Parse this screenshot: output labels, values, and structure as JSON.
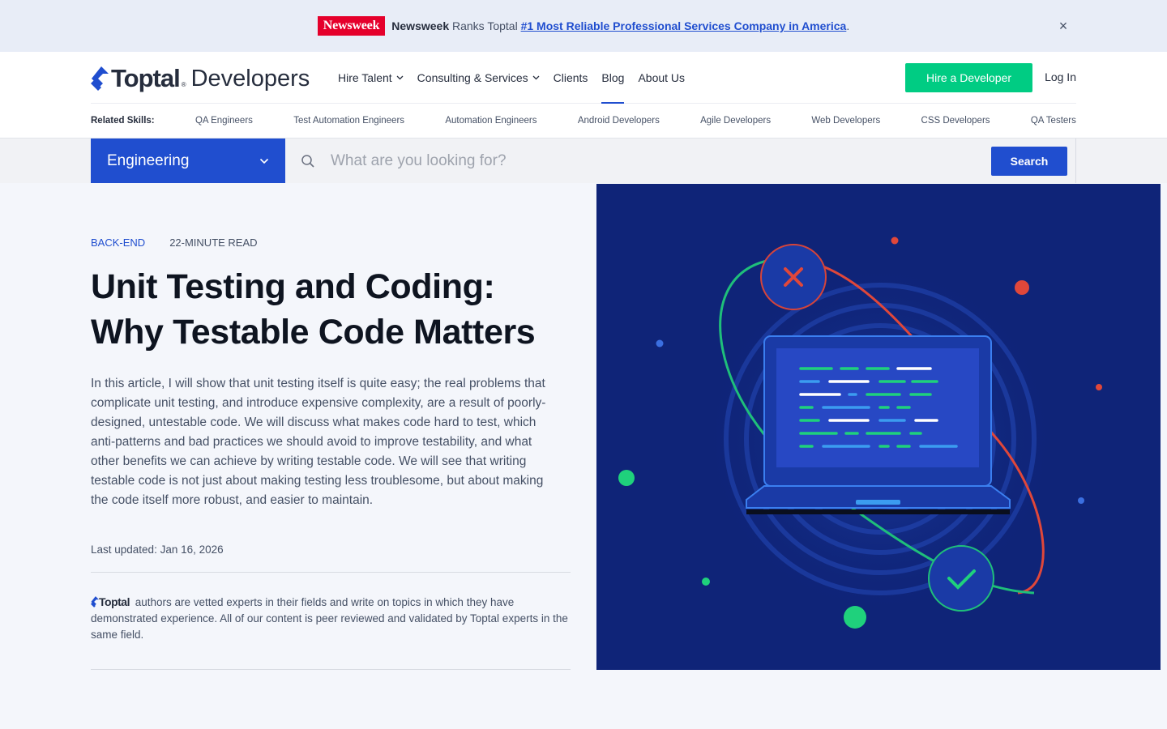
{
  "announcement": {
    "logo_text": "Newsweek",
    "brand": "Newsweek",
    "text": "Ranks Toptal",
    "link": "#1 Most Reliable Professional Services Company in America",
    "period": ".",
    "close": "×"
  },
  "header": {
    "logo_word": "Toptal",
    "logo_reg": "®",
    "logo_suffix": "Developers",
    "nav": [
      {
        "label": "Hire Talent",
        "chevron": true
      },
      {
        "label": "Consulting & Services",
        "chevron": true
      },
      {
        "label": "Clients",
        "chevron": false
      },
      {
        "label": "Blog",
        "chevron": false,
        "active": true
      },
      {
        "label": "About Us",
        "chevron": false
      }
    ],
    "hire_button": "Hire a Developer",
    "login": "Log In"
  },
  "skills": {
    "label": "Related Skills:",
    "items": [
      "QA Engineers",
      "Test Automation Engineers",
      "Automation Engineers",
      "Android Developers",
      "Agile Developers",
      "Web Developers",
      "CSS Developers",
      "QA Testers"
    ]
  },
  "search": {
    "category": "Engineering",
    "placeholder": "What are you looking for?",
    "button": "Search"
  },
  "article": {
    "category": "BACK-END",
    "read_time": "22-MINUTE READ",
    "title_line1": "Unit Testing and Coding:",
    "title_line2": "Why Testable Code Matters",
    "summary": "In this article, I will show that unit testing itself is quite easy; the real problems that complicate unit testing, and introduce expensive complexity, are a result of poorly-designed, untestable code. We will discuss what makes code hard to test, which anti-patterns and bad practices we should avoid to improve testability, and what other benefits we can achieve by writing testable code. We will see that writing testable code is not just about making testing less troublesome, but about making the code itself more robust, and easier to maintain.",
    "updated": "Last updated: Jan 16, 2026",
    "vetted_logo": "Toptal",
    "vetted_text": "authors are vetted experts in their fields and write on topics in which they have demonstrated experience. All of our content is peer reviewed and validated by Toptal experts in the same field."
  },
  "colors": {
    "brand_blue": "#204ecf",
    "green": "#00cc83",
    "hero_bg": "#0f2478",
    "newsweek_red": "#e5002b"
  }
}
